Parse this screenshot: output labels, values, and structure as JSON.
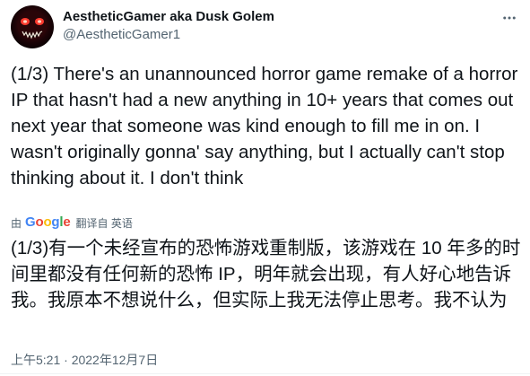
{
  "author": {
    "display_name": "AestheticGamer aka Dusk Golem",
    "handle": "@AestheticGamer1",
    "avatar_icon": "demon-face-avatar"
  },
  "tweet": {
    "text": "(1/3) There's an unannounced horror game remake of a horror IP that hasn't had a new anything in 10+ years that comes out next year that someone was kind enough to fill me in on. I wasn't originally gonna' say anything, but I actually can't stop thinking about it. I don't think"
  },
  "translation": {
    "by_label": "由",
    "provider_letters": [
      {
        "ch": "G",
        "color": "#4285F4"
      },
      {
        "ch": "o",
        "color": "#EA4335"
      },
      {
        "ch": "o",
        "color": "#FBBC05"
      },
      {
        "ch": "g",
        "color": "#4285F4"
      },
      {
        "ch": "l",
        "color": "#34A853"
      },
      {
        "ch": "e",
        "color": "#EA4335"
      }
    ],
    "link_label": "翻译自 英语",
    "text": "(1/3)有一个未经宣布的恐怖游戏重制版，该游戏在 10 年多的时间里都没有任何新的恐怖 IP，明年就会出现，有人好心地告诉我。我原本不想说什么，但实际上我无法停止思考。我不认为"
  },
  "meta": {
    "timestamp": "上午5:21 · 2022年12月7日"
  },
  "icons": {
    "more": "more-options-icon"
  }
}
